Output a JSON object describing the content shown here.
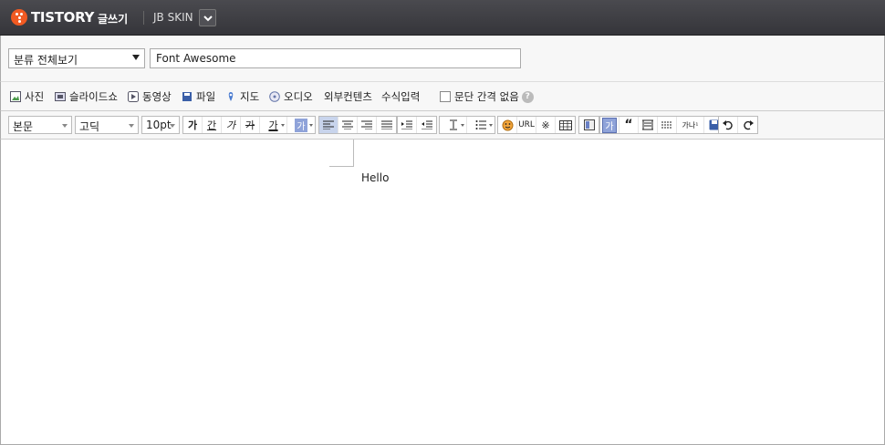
{
  "header": {
    "logo_text": "TISTORY",
    "write_label": "글쓰기",
    "blog_name": "JB SKIN",
    "brand_color": "#f15a22"
  },
  "post": {
    "category": "분류 전체보기",
    "title": "Font Awesome"
  },
  "attachments": [
    {
      "label": "사진",
      "icon": "photo-icon"
    },
    {
      "label": "슬라이드쇼",
      "icon": "slideshow-icon"
    },
    {
      "label": "동영상",
      "icon": "video-icon"
    },
    {
      "label": "파일",
      "icon": "file-icon"
    },
    {
      "label": "지도",
      "icon": "map-pin-icon"
    },
    {
      "label": "오디오",
      "icon": "audio-icon"
    },
    {
      "label": "외부컨텐츠"
    },
    {
      "label": "수식입력"
    }
  ],
  "no_paragraph_spacing_label": "문단 간격 없음",
  "toolbar": {
    "paragraph_style": "본문",
    "font": "고딕",
    "font_size": "10pt",
    "bold": "가",
    "underline": "간",
    "italic": "가",
    "strike": "가",
    "font_color": "가",
    "bg_color": "가",
    "url": "URL",
    "special_char": "※",
    "custom_tag": "가",
    "more": "가나¹"
  },
  "editor": {
    "content": "Hello"
  }
}
